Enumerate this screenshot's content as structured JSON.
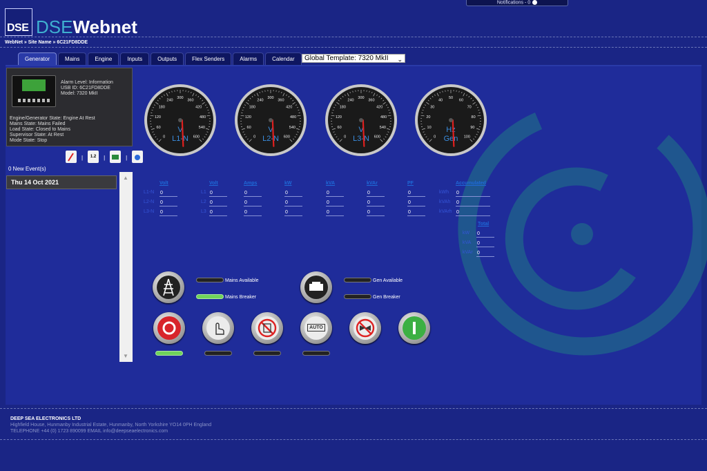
{
  "notifications": {
    "label": "Notifications - 0"
  },
  "header": {
    "logo_mark": "DSE",
    "logo_dse": "DSE",
    "logo_webnet": "Webnet",
    "breadcrumb": "WebNet » Site Name » 6C21FD8DDE"
  },
  "tabs": [
    {
      "label": "Generator",
      "active": true
    },
    {
      "label": "Mains"
    },
    {
      "label": "Engine"
    },
    {
      "label": "Inputs"
    },
    {
      "label": "Outputs"
    },
    {
      "label": "Flex Senders"
    },
    {
      "label": "Alarms"
    },
    {
      "label": "Calendar"
    }
  ],
  "template_select": {
    "value": "Global Template: 7320 MkII"
  },
  "info": {
    "alarm_level": "Alarm Level: Information",
    "usb_id": "USB ID: 6C21FD8DDE",
    "model": "Model: 7320 MkII",
    "engine_state": "Engine/Generator State: Engine At Rest",
    "mains_state": "Mains State: Mains Failed",
    "load_state": "Load State: Closed to Mains",
    "supervisor_state": "Supervisor State: At Rest",
    "mode_state": "Mode State: Stop"
  },
  "events": {
    "new_events": "0 New Event(s)",
    "date": "Thu 14 Oct 2021"
  },
  "gauges": [
    {
      "unit": "V",
      "label": "L1-N",
      "ticks": [
        "0",
        "60",
        "120",
        "180",
        "240",
        "300",
        "360",
        "420",
        "480",
        "540",
        "600"
      ],
      "value": 0
    },
    {
      "unit": "V",
      "label": "L2-N",
      "ticks": [
        "0",
        "60",
        "120",
        "180",
        "240",
        "300",
        "360",
        "420",
        "480",
        "540",
        "600"
      ],
      "value": 0
    },
    {
      "unit": "V",
      "label": "L3-N",
      "ticks": [
        "0",
        "60",
        "120",
        "180",
        "240",
        "300",
        "360",
        "420",
        "480",
        "540",
        "600"
      ],
      "value": 0
    },
    {
      "unit": "Hz",
      "label": "Gen",
      "ticks": [
        "0",
        "10",
        "20",
        "30",
        "40",
        "50",
        "60",
        "70",
        "80",
        "90",
        "100"
      ],
      "value": 0
    }
  ],
  "table": {
    "headers": [
      "Volt",
      "Volt",
      "Amps",
      "kW",
      "kVA",
      "kVAr",
      "PF",
      "Accumulated"
    ],
    "rows": [
      {
        "label": "L1-N",
        "label2": "L1",
        "values": [
          "0",
          "0",
          "0",
          "0",
          "0",
          "0",
          "0"
        ]
      },
      {
        "label": "L2-N",
        "label2": "L2",
        "values": [
          "0",
          "0",
          "0",
          "0",
          "0",
          "0",
          "0"
        ]
      },
      {
        "label": "L3-N",
        "label2": "L3",
        "values": [
          "0",
          "0",
          "0",
          "0",
          "0",
          "0",
          "0"
        ]
      }
    ],
    "accumulated": [
      {
        "label": "kWh",
        "value": "0"
      },
      {
        "label": "kVAh",
        "value": "0"
      },
      {
        "label": "kVArh",
        "value": "0"
      }
    ],
    "total_header": "Total",
    "total": [
      {
        "label": "kW",
        "value": "0"
      },
      {
        "label": "kVA",
        "value": "0"
      },
      {
        "label": "kVAr",
        "value": "0"
      }
    ]
  },
  "status": {
    "mains_available": "Mains Available",
    "mains_breaker": "Mains Breaker",
    "gen_available": "Gen Available",
    "gen_breaker": "Gen Breaker"
  },
  "controls": {
    "auto_label": "AUTO"
  },
  "footer": {
    "company": "DEEP SEA ELECTRONICS LTD",
    "address": "Highfield House, Hunmanby Industrial Estate, Hunmanby, North Yorkshire YO14 0PH England",
    "contact": "TELEPHONE +44 (0) 1723 890099   EMAIL info@deepseaelectronics.com"
  }
}
